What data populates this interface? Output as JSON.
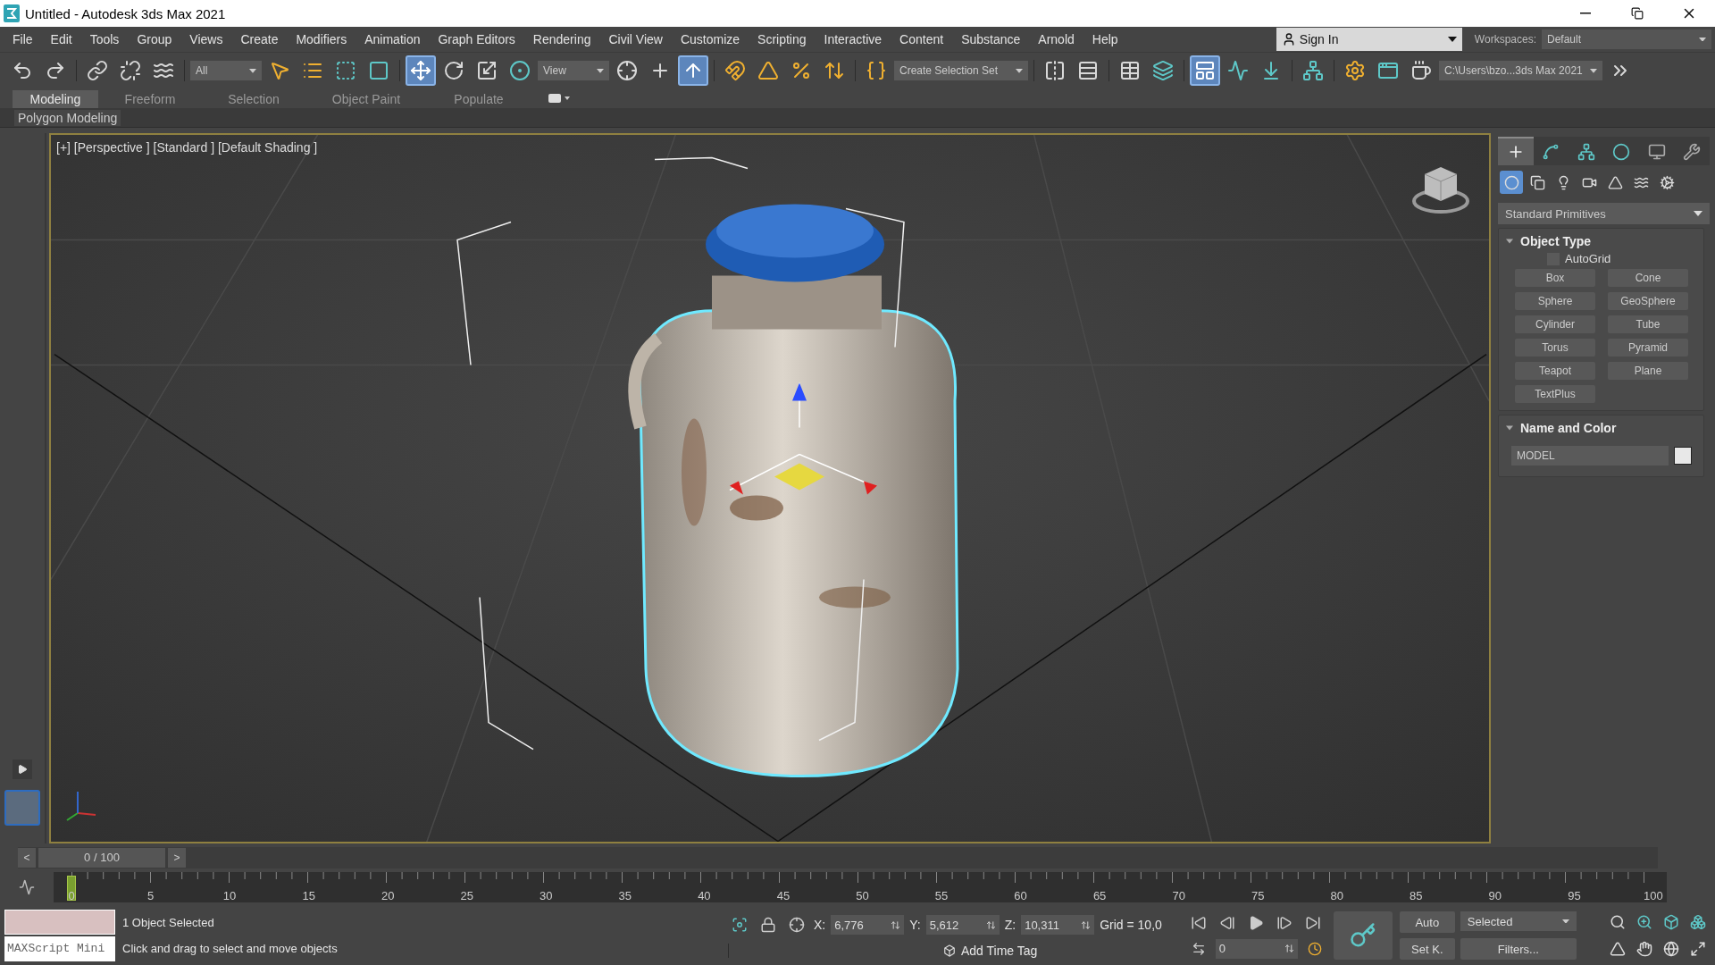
{
  "window": {
    "title": "Untitled - Autodesk 3ds Max 2021"
  },
  "menu": [
    "File",
    "Edit",
    "Tools",
    "Group",
    "Views",
    "Create",
    "Modifiers",
    "Animation",
    "Graph Editors",
    "Rendering",
    "Civil View",
    "Customize",
    "Scripting",
    "Interactive",
    "Content",
    "Substance",
    "Arnold",
    "Help"
  ],
  "sign_in": {
    "label": "Sign In"
  },
  "workspaces": {
    "label": "Workspaces:",
    "value": "Default"
  },
  "toolbar": [
    {
      "kind": "button",
      "selected": false
    },
    {
      "kind": "button",
      "selected": false
    },
    {
      "kind": "separator"
    },
    {
      "kind": "button",
      "selected": false
    },
    {
      "kind": "button",
      "selected": false
    },
    {
      "kind": "button",
      "selected": false
    },
    {
      "kind": "separator"
    },
    {
      "kind": "dropdown",
      "value": "All"
    },
    {
      "kind": "button",
      "selected": false
    },
    {
      "kind": "button",
      "selected": false
    },
    {
      "kind": "button",
      "selected": false
    },
    {
      "kind": "button",
      "selected": false
    },
    {
      "kind": "separator"
    },
    {
      "kind": "button",
      "selected": true
    },
    {
      "kind": "button",
      "selected": false
    },
    {
      "kind": "button",
      "selected": false
    },
    {
      "kind": "button",
      "selected": false
    },
    {
      "kind": "dropdown",
      "value": "View"
    },
    {
      "kind": "button",
      "selected": false
    },
    {
      "kind": "button",
      "selected": false
    },
    {
      "kind": "button",
      "selected": true
    },
    {
      "kind": "separator"
    },
    {
      "kind": "button",
      "selected": false
    },
    {
      "kind": "button",
      "selected": false
    },
    {
      "kind": "button",
      "selected": false
    },
    {
      "kind": "button",
      "selected": false
    },
    {
      "kind": "separator"
    },
    {
      "kind": "button",
      "selected": false
    },
    {
      "kind": "dropdown",
      "value": "Create Selection Set"
    },
    {
      "kind": "separator"
    },
    {
      "kind": "button",
      "selected": false
    },
    {
      "kind": "button",
      "selected": false
    },
    {
      "kind": "separator"
    },
    {
      "kind": "button",
      "selected": false
    },
    {
      "kind": "button",
      "selected": false
    },
    {
      "kind": "separator"
    },
    {
      "kind": "button",
      "selected": true
    },
    {
      "kind": "button",
      "selected": false
    },
    {
      "kind": "button",
      "selected": false
    },
    {
      "kind": "separator"
    },
    {
      "kind": "button",
      "selected": false
    },
    {
      "kind": "separator"
    },
    {
      "kind": "button",
      "selected": false
    },
    {
      "kind": "button",
      "selected": false
    },
    {
      "kind": "button",
      "selected": false
    },
    {
      "kind": "dropdown",
      "value": "C:\\Users\\bzo...3ds Max 2021"
    },
    {
      "kind": "button",
      "selected": false
    }
  ],
  "ribbon_tabs": [
    {
      "label": "Modeling",
      "selected": true
    },
    {
      "label": "Freeform",
      "selected": false
    },
    {
      "label": "Selection",
      "selected": false
    },
    {
      "label": "Object Paint",
      "selected": false
    },
    {
      "label": "Populate",
      "selected": false
    }
  ],
  "ribbon_panel": "Polygon Modeling",
  "viewport": {
    "label": "[+] [Perspective ] [Standard ] [Default Shading ]"
  },
  "command_panel": {
    "tabs": [
      {
        "selected": true
      },
      {
        "selected": false
      },
      {
        "selected": false
      },
      {
        "selected": false
      },
      {
        "selected": false
      },
      {
        "selected": false
      }
    ],
    "categories": [
      {
        "selected": true
      },
      {
        "selected": false
      },
      {
        "selected": false
      },
      {
        "selected": false
      },
      {
        "selected": false
      },
      {
        "selected": false
      },
      {
        "selected": false
      }
    ],
    "type": "Standard Primitives",
    "object_type": {
      "title": "Object Type",
      "expanded": true,
      "autogrid": {
        "label": "AutoGrid",
        "checked": false
      },
      "buttons": [
        "Box",
        "Cone",
        "Sphere",
        "GeoSphere",
        "Cylinder",
        "Tube",
        "Torus",
        "Pyramid",
        "Teapot",
        "Plane",
        "TextPlus"
      ]
    },
    "name_and_color": {
      "title": "Name and Color",
      "expanded": true,
      "name": "MODEL"
    }
  },
  "time_slider": {
    "prev": "<",
    "position": "0 / 100",
    "next": ">"
  },
  "timeline": {
    "labels": [
      "0",
      "5",
      "10",
      "15",
      "20",
      "25",
      "30",
      "35",
      "40",
      "45",
      "50",
      "55",
      "60",
      "65",
      "70",
      "75",
      "80",
      "85",
      "90",
      "95",
      "100"
    ],
    "level": 0
  },
  "status": {
    "maxscript": "MAXScript Mini",
    "selection": "1 Object Selected",
    "prompt": "Click and drag to select and move objects",
    "coords": [
      {
        "label": "X:",
        "value": "6,776"
      },
      {
        "label": "Y:",
        "value": "5,612"
      },
      {
        "label": "Z:",
        "value": "10,311"
      }
    ],
    "grid": "Grid = 10,0",
    "add_time_tag": "Add Time Tag",
    "frame": "0",
    "auto": "Auto",
    "key_filter": "Selected",
    "set_key": "Set K.",
    "filters": "Filters..."
  }
}
